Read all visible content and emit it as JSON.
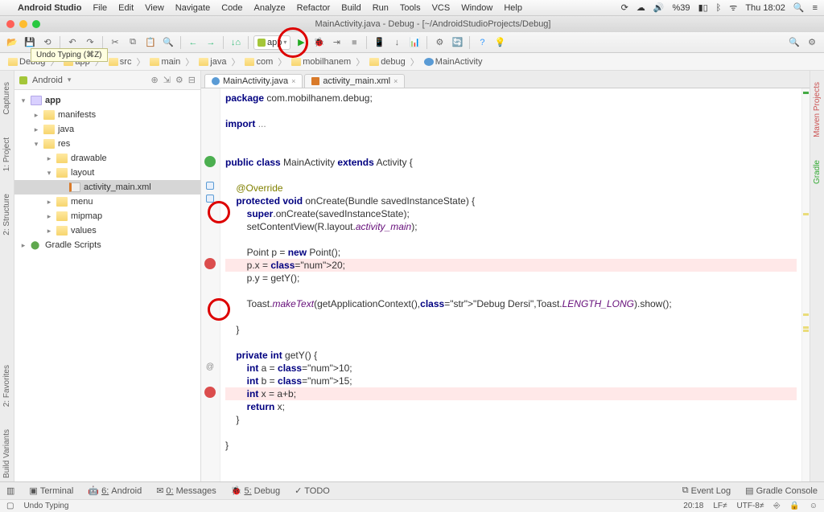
{
  "mac_menu": {
    "app_name": "Android Studio",
    "items": [
      "File",
      "Edit",
      "View",
      "Navigate",
      "Code",
      "Analyze",
      "Refactor",
      "Build",
      "Run",
      "Tools",
      "VCS",
      "Window",
      "Help"
    ],
    "battery_pct": "%39",
    "clock": "Thu 18:02"
  },
  "window_title": "MainActivity.java - Debug - [~/AndroidStudioProjects/Debug]",
  "tooltip": "Undo Typing (⌘Z)",
  "run_config_label": "app",
  "breadcrumbs": [
    "Debug",
    "app",
    "src",
    "main",
    "java",
    "com",
    "mobilhanem",
    "debug",
    "MainActivity"
  ],
  "project_panel": {
    "title": "Android",
    "tree": [
      {
        "d": 0,
        "tw": "▾",
        "ico": "module",
        "label": "app",
        "bold": true
      },
      {
        "d": 1,
        "tw": "▸",
        "ico": "folder",
        "label": "manifests"
      },
      {
        "d": 1,
        "tw": "▸",
        "ico": "folder",
        "label": "java"
      },
      {
        "d": 1,
        "tw": "▾",
        "ico": "folder",
        "label": "res"
      },
      {
        "d": 2,
        "tw": "▸",
        "ico": "folder",
        "label": "drawable"
      },
      {
        "d": 2,
        "tw": "▾",
        "ico": "folder",
        "label": "layout"
      },
      {
        "d": 3,
        "tw": "",
        "ico": "xml",
        "label": "activity_main.xml",
        "sel": true
      },
      {
        "d": 2,
        "tw": "▸",
        "ico": "folder",
        "label": "menu"
      },
      {
        "d": 2,
        "tw": "▸",
        "ico": "folder",
        "label": "mipmap"
      },
      {
        "d": 2,
        "tw": "▸",
        "ico": "folder",
        "label": "values"
      },
      {
        "d": 0,
        "tw": "▸",
        "ico": "gradle",
        "label": "Gradle Scripts"
      }
    ]
  },
  "left_rails": [
    "Captures",
    "1: Project",
    "2: Structure"
  ],
  "left_rails2": [
    "2: Favorites",
    "Build Variants"
  ],
  "right_rails": [
    "Maven Projects",
    "Gradle"
  ],
  "editor_tabs": [
    {
      "label": "MainActivity.java",
      "active": true,
      "icon": "cls"
    },
    {
      "label": "activity_main.xml",
      "active": false,
      "icon": "xml"
    }
  ],
  "code_plain": "package com.mobilhanem.debug;\n\nimport ...\n\n\npublic class MainActivity extends Activity {\n\n    @Override\n    protected void onCreate(Bundle savedInstanceState) {\n        super.onCreate(savedInstanceState);\n        setContentView(R.layout.activity_main);\n\n        Point p = new Point();\n        p.x = 20;\n        p.y = getY();\n\n        Toast.makeText(getApplicationContext(),\"Debug Dersi\",Toast.LENGTH_LONG).show();\n\n    }\n\n    private int getY() {\n        int a = 10;\n        int b = 15;\n        int x = a+b;\n        return x;\n    }\n\n}",
  "bottom_tabs": {
    "left": [
      {
        "icon": "▣",
        "n": "",
        "label": "Terminal"
      },
      {
        "icon": "🤖",
        "n": "6:",
        "label": "Android"
      },
      {
        "icon": "✉",
        "n": "0:",
        "label": "Messages"
      },
      {
        "icon": "🐞",
        "n": "5:",
        "label": "Debug"
      },
      {
        "icon": "✓",
        "n": "",
        "label": "TODO"
      }
    ],
    "right": [
      {
        "icon": "⧉",
        "label": "Event Log"
      },
      {
        "icon": "▤",
        "label": "Gradle Console"
      }
    ]
  },
  "status": {
    "msg": "Undo Typing",
    "pos": "20:18",
    "sep": "LF≠",
    "enc": "UTF-8≠"
  }
}
